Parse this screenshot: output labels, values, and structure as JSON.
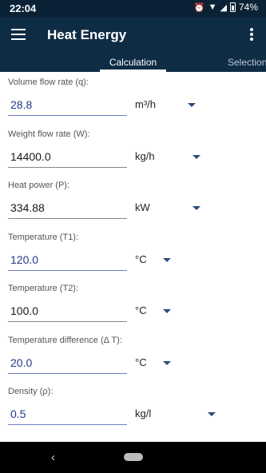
{
  "status": {
    "time": "22:04",
    "battery": "74%"
  },
  "app": {
    "title": "Heat Energy"
  },
  "tabs": [
    {
      "label": "Calculation"
    },
    {
      "label": "Selection"
    }
  ],
  "fields": [
    {
      "label": "Volume flow rate (q):",
      "value": "28.8",
      "unit": "m³/h"
    },
    {
      "label": "Weight flow rate (W):",
      "value": "14400.0",
      "unit": "kg/h"
    },
    {
      "label": "Heat power (P):",
      "value": "334.88",
      "unit": "kW"
    },
    {
      "label": "Temperature (T1):",
      "value": "120.0",
      "unit": "°C"
    },
    {
      "label": "Temperature (T2):",
      "value": "100.0",
      "unit": "°C"
    },
    {
      "label": "Temperature difference (Δ T):",
      "value": "20.0",
      "unit": "°C"
    },
    {
      "label": "Density (ρ):",
      "value": "0.5",
      "unit": "kg/l"
    }
  ]
}
